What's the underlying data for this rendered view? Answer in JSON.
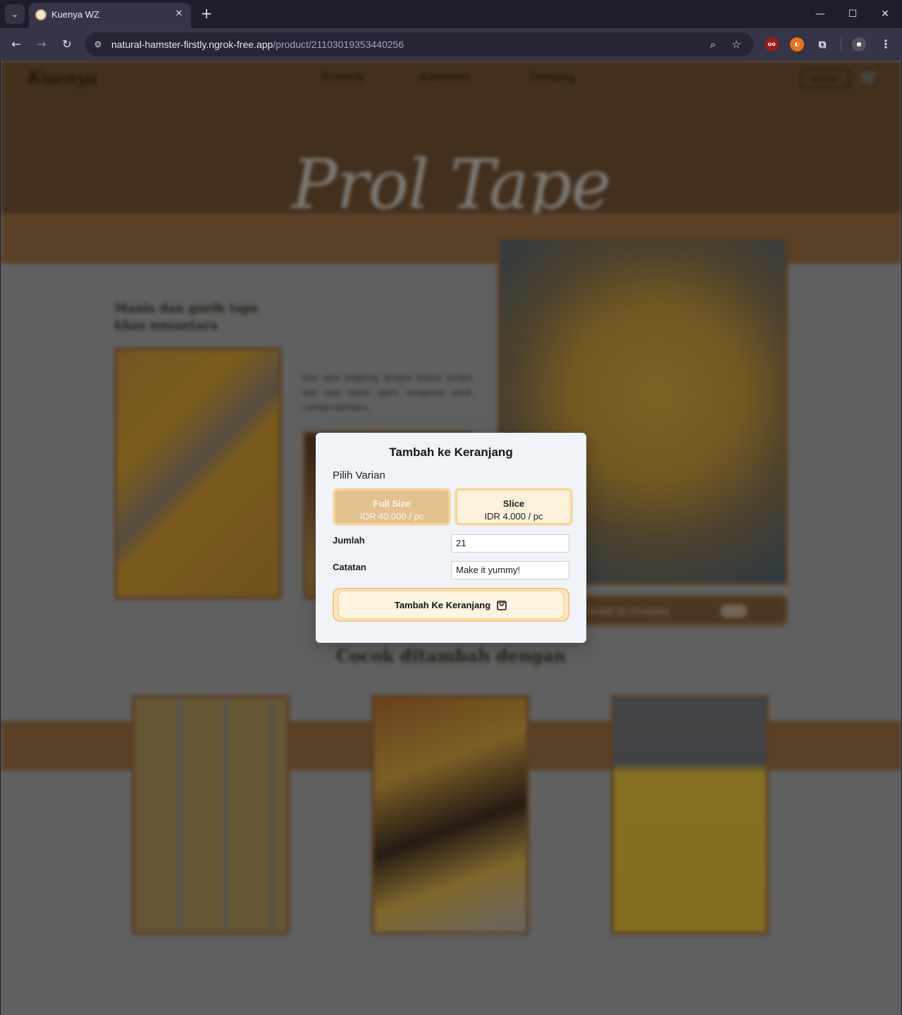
{
  "browser": {
    "tab_title": "Kuenya WZ",
    "url_host": "natural-hamster-firstly.ngrok-free.app",
    "url_path": "/product/21103019353440256"
  },
  "site": {
    "nav": [
      "Produk",
      "Kalender",
      "Tentang"
    ],
    "logout_label": "Keluar",
    "hero_title": "Prol Tape",
    "subtitle": "Manis dan gurih tape khas nusantara",
    "description": "Kue tape singkong dengan tekstur lembut dan rasa manis alami, sempurna untuk camilan istimewa.",
    "add_bar_label": "Tambah Ke Keranjang",
    "related_title": "Cocok ditambah dengan"
  },
  "modal": {
    "title": "Tambah ke Keranjang",
    "variant_label": "Pilih Varian",
    "variants": [
      {
        "name": "Full Size",
        "price": "IDR 40.000 / pc",
        "selected": true
      },
      {
        "name": "Slice",
        "price": "IDR 4.000 / pc",
        "selected": false
      }
    ],
    "quantity_label": "Jumlah",
    "quantity_value": "21",
    "notes_label": "Catatan",
    "notes_value": "Make it yummy!",
    "submit_label": "Tambah Ke Keranjang"
  },
  "colors": {
    "selected_variant": "#e4c28f",
    "variant_border": "#f5d49b",
    "button_bg": "#fff4e0",
    "hero_bg": "#6b4c2f"
  }
}
